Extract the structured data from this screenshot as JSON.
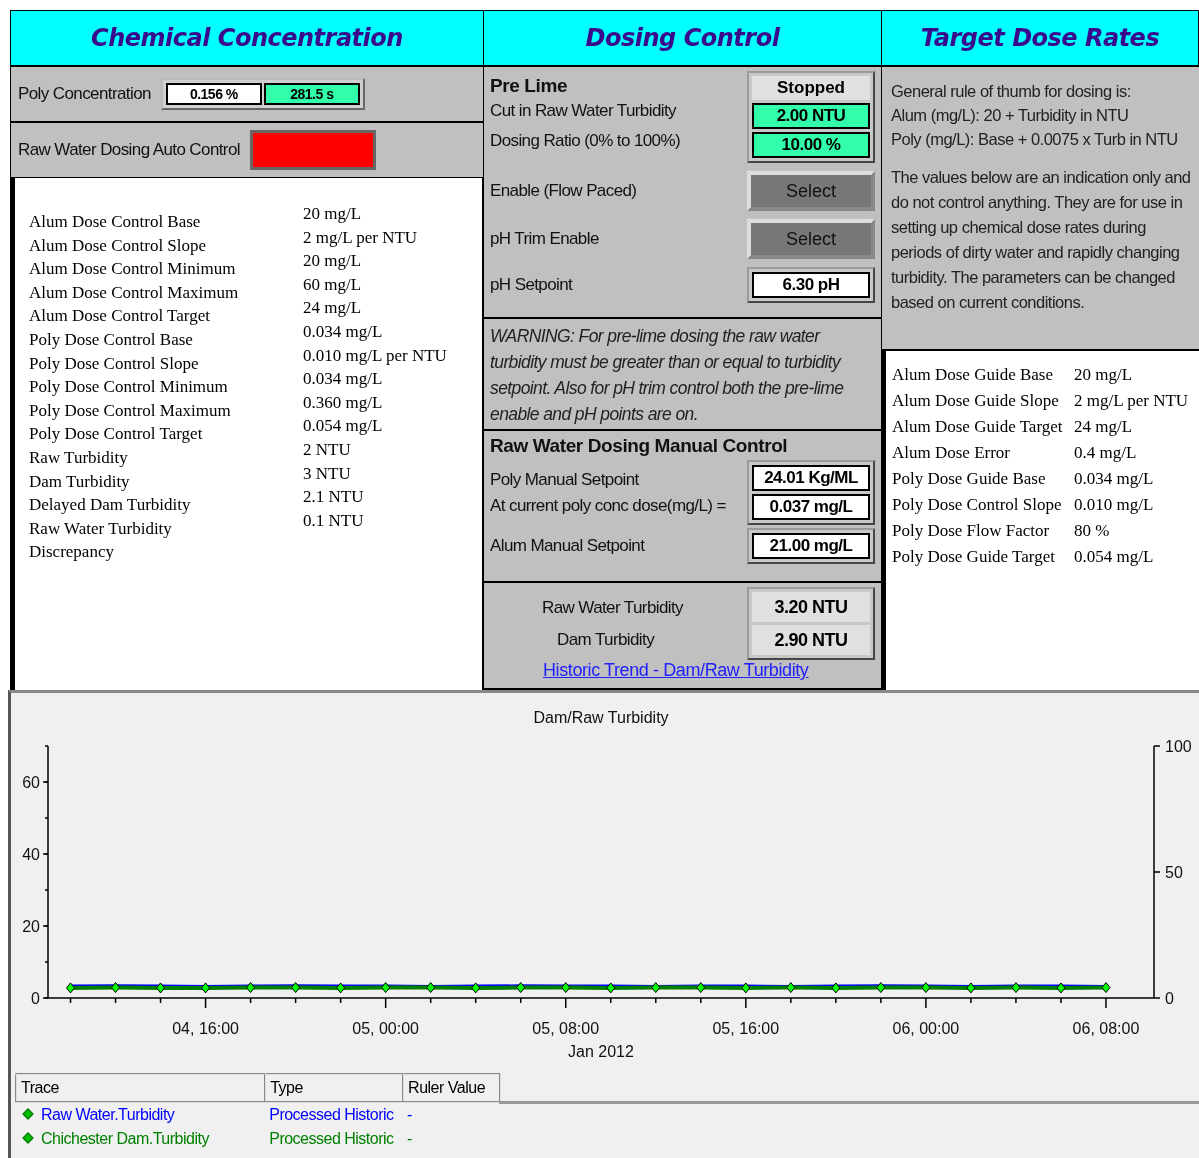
{
  "chemical_concentration": {
    "title": "Chemical Concentration",
    "poly_concentration": {
      "label": "Poly Concentration",
      "value": "0.156 %",
      "time": "281.5 s"
    },
    "auto_control": {
      "label": "Raw Water Dosing Auto Control",
      "on": false
    },
    "parameters": [
      {
        "label": "Alum Dose Control Base",
        "value": "20 mg/L"
      },
      {
        "label": "Alum Dose Control Slope",
        "value": "2 mg/L per NTU"
      },
      {
        "label": "Alum Dose Control Minimum",
        "value": "20 mg/L"
      },
      {
        "label": "Alum Dose Control Maximum",
        "value": "60 mg/L"
      },
      {
        "label": "Alum Dose Control Target",
        "value": "24 mg/L"
      },
      {
        "label": "Poly Dose Control Base",
        "value": "0.034 mg/L"
      },
      {
        "label": "Poly Dose Control Slope",
        "value": "0.010 mg/L per NTU"
      },
      {
        "label": "Poly Dose Control Minimum",
        "value": "0.034 mg/L"
      },
      {
        "label": "Poly Dose Control Maximum",
        "value": "0.360 mg/L"
      },
      {
        "label": "Poly Dose Control Target",
        "value": "0.054 mg/L"
      },
      {
        "label": "Raw Turbidity",
        "value": "2 NTU"
      },
      {
        "label": "Dam Turbidity",
        "value": "3 NTU"
      },
      {
        "label": "Delayed Dam Turbidity",
        "value": "2.1 NTU"
      },
      {
        "label": "Raw Water Turbidity Discrepancy",
        "value": "0.1 NTU"
      }
    ]
  },
  "dosing_control": {
    "title": "Dosing Control",
    "pre_lime": {
      "title": "Pre Lime",
      "status": "Stopped",
      "rows": [
        {
          "label": "Cut in Raw Water Turbidity",
          "value": "2.00 NTU"
        },
        {
          "label": "Dosing Ratio (0% to 100%)",
          "value": "10.00 %"
        }
      ]
    },
    "selects": [
      {
        "label": "Enable (Flow Paced)",
        "button": "Select"
      },
      {
        "label": "pH Trim Enable",
        "button": "Select"
      }
    ],
    "ph_setpoint": {
      "label": "pH Setpoint",
      "value": "6.30 pH"
    },
    "warning": "WARNING: For pre-lime dosing the raw water turbidity must be greater than or equal to turbidity setpoint. Also for pH trim control both the pre-lime enable and pH points are on.",
    "manual": {
      "title": "Raw Water Dosing Manual Control",
      "poly_setpoint": {
        "label": "Poly Manual Setpoint",
        "value": "24.01 Kg/ML"
      },
      "poly_dose": {
        "label": "At current poly conc dose(mg/L) =",
        "value": "0.037 mg/L"
      },
      "alum_setpoint": {
        "label": "Alum Manual Setpoint",
        "value": "21.00 mg/L"
      }
    },
    "turbidity": [
      {
        "label": "Raw Water Turbidity",
        "value": "3.20 NTU"
      },
      {
        "label": "Dam Turbidity",
        "value": "2.90 NTU"
      }
    ],
    "trend_link": "Historic Trend - Dam/Raw Turbidity"
  },
  "target_dose_rates": {
    "title": "Target Dose Rates",
    "rule_lines": [
      "General rule of thumb for dosing is:",
      "Alum (mg/L): 20 + Turbidity in NTU",
      "Poly (mg/L): Base + 0.0075 x Turb in NTU"
    ],
    "note": "The values below are an indication only and do not control anything. They are for use in setting up chemical dose rates during periods of dirty water and rapidly changing turbidity. The parameters can be changed based on current conditions.",
    "guides": [
      {
        "label": "Alum Dose Guide Base",
        "value": "20 mg/L"
      },
      {
        "label": "Alum Dose Guide Slope",
        "value": "2 mg/L per NTU"
      },
      {
        "label": "Alum Dose Guide Target",
        "value": "24 mg/L"
      },
      {
        "label": "Alum Dose Error",
        "value": "0.4 mg/L"
      },
      {
        "label": "Poly Dose Guide Base",
        "value": "0.034 mg/L"
      },
      {
        "label": "Poly Dose Control Slope",
        "value": "0.010 mg/L"
      },
      {
        "label": "Poly Dose Flow Factor",
        "value": "80 %"
      },
      {
        "label": "Poly Dose Guide Target",
        "value": "0.054 mg/L"
      }
    ]
  },
  "trend": {
    "chart_data": {
      "type": "line",
      "title": "Dam/Raw Turbidity",
      "xlabel": "Jan 2012",
      "ylim": [
        0,
        70
      ],
      "y2lim": [
        0,
        100
      ],
      "categories": [
        null,
        null,
        null,
        "04, 16:00",
        null,
        null,
        null,
        "05, 00:00",
        null,
        null,
        null,
        "05, 08:00",
        null,
        null,
        null,
        "05, 16:00",
        null,
        null,
        null,
        "06, 00:00",
        null,
        null,
        null,
        "06, 08:00"
      ],
      "yticks": [
        0,
        20,
        40,
        60
      ],
      "y2ticks": [
        0,
        50,
        100
      ],
      "series": [
        {
          "name": "Raw Water.Turbidity",
          "color": "#0000ff",
          "values": [
            3.3,
            3.4,
            3.3,
            3.2,
            3.3,
            3.4,
            3.3,
            3.3,
            3.2,
            3.3,
            3.4,
            3.3,
            3.3,
            3.2,
            3.3,
            3.3,
            3.2,
            3.3,
            3.4,
            3.3,
            3.2,
            3.3,
            3.3,
            3.2
          ]
        },
        {
          "name": "Chichester Dam.Turbidity",
          "color": "#008000",
          "marker": "diamond",
          "values": [
            2.8,
            2.9,
            2.8,
            2.8,
            2.9,
            2.9,
            2.8,
            2.9,
            2.9,
            2.8,
            2.9,
            2.9,
            2.8,
            2.9,
            2.9,
            2.8,
            2.9,
            2.8,
            2.9,
            2.9,
            2.8,
            2.9,
            2.8,
            2.9
          ]
        }
      ]
    },
    "legend": {
      "columns": [
        "Trace",
        "Type",
        "Ruler Value"
      ],
      "rows": [
        {
          "type": "Processed Historic",
          "ruler": "-"
        },
        {
          "type": "Processed Historic",
          "ruler": "-"
        }
      ]
    }
  }
}
